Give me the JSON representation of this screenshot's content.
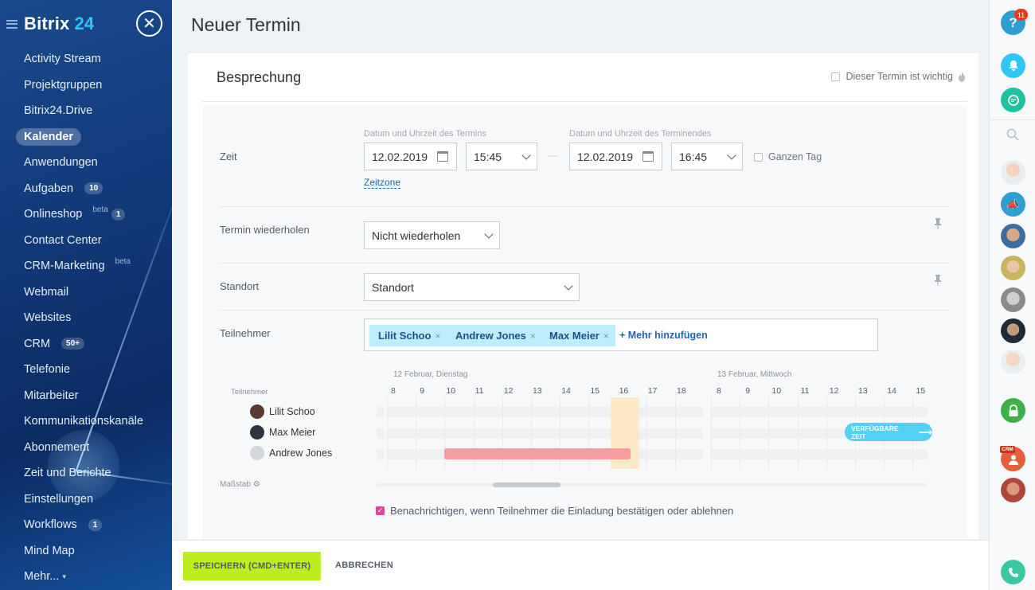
{
  "sidebar": {
    "logo_main": "Bitrix",
    "logo_num": "24",
    "items": [
      {
        "label": "Activity Stream",
        "sup": "",
        "count": ""
      },
      {
        "label": "Projektgruppen",
        "sup": "",
        "count": ""
      },
      {
        "label": "Bitrix24.Drive",
        "sup": "",
        "count": ""
      },
      {
        "label": "Kalender",
        "sup": "",
        "count": "",
        "active": true
      },
      {
        "label": "Anwendungen",
        "sup": "",
        "count": ""
      },
      {
        "label": "Aufgaben",
        "sup": "",
        "count": "10"
      },
      {
        "label": "Onlineshop",
        "sup": "beta",
        "count": "1"
      },
      {
        "label": "Contact Center",
        "sup": "",
        "count": ""
      },
      {
        "label": "CRM-Marketing",
        "sup": "beta",
        "count": ""
      },
      {
        "label": "Webmail",
        "sup": "",
        "count": ""
      },
      {
        "label": "Websites",
        "sup": "",
        "count": ""
      },
      {
        "label": "CRM",
        "sup": "",
        "count": "50+"
      },
      {
        "label": "Telefonie",
        "sup": "",
        "count": ""
      },
      {
        "label": "Mitarbeiter",
        "sup": "",
        "count": ""
      },
      {
        "label": "Kommunikationskanäle",
        "sup": "",
        "count": ""
      },
      {
        "label": "Abonnement",
        "sup": "",
        "count": ""
      },
      {
        "label": "Zeit und Berichte",
        "sup": "",
        "count": ""
      },
      {
        "label": "Einstellungen",
        "sup": "",
        "count": ""
      },
      {
        "label": "Workflows",
        "sup": "",
        "count": "1"
      },
      {
        "label": "Mind Map",
        "sup": "",
        "count": ""
      },
      {
        "label": "Mehr...",
        "sup": "",
        "count": ""
      }
    ]
  },
  "page": {
    "title": "Neuer Termin"
  },
  "card": {
    "title": "Besprechung",
    "important_label": "Dieser Termin ist wichtig"
  },
  "time": {
    "label": "Zeit",
    "start_caption": "Datum und Uhrzeit des Termins",
    "end_caption": "Datum und Uhrzeit des Terminendes",
    "start_date": "12.02.2019",
    "start_time": "15:45",
    "end_date": "12.02.2019",
    "end_time": "16:45",
    "separator": "—",
    "all_day_label": "Ganzen Tag",
    "timezone_link": "Zeitzone"
  },
  "repeat": {
    "label": "Termin wiederholen",
    "value": "Nicht wiederholen"
  },
  "location": {
    "label": "Standort",
    "placeholder": "Standort"
  },
  "participants": {
    "label": "Teilnehmer",
    "tags": [
      "Lilit Schoo",
      "Andrew Jones",
      "Max Meier"
    ],
    "tag_remove": "×",
    "add_more": "+ Mehr hinzufügen"
  },
  "timeline": {
    "col_label": "Teilnehmer",
    "day1": "12 Februar, Dienstag",
    "day2": "13 Februar, Mittwoch",
    "hours_day1": [
      "8",
      "9",
      "10",
      "11",
      "12",
      "13",
      "14",
      "15",
      "16",
      "17",
      "18"
    ],
    "hours_day2": [
      "8",
      "9",
      "10",
      "11",
      "12",
      "13",
      "14",
      "15"
    ],
    "people": [
      "Lilit Schoo",
      "Max Meier",
      "Andrew Jones"
    ],
    "busy": {
      "person": "Andrew Jones",
      "from": 10,
      "to": 17
    },
    "selected": {
      "from": 15.75,
      "to": 16.75
    },
    "free_time_button": "VERFÜGBARE ZEIT",
    "scale_label": "Maßstab",
    "busy_color": "#f79c9f",
    "selected_color": "#fde6bc"
  },
  "notify": {
    "label": "Benachrichtigen, wenn Teilnehmer die Einladung bestätigen oder ablehnen",
    "checked": true
  },
  "footer": {
    "save": "SPEICHERN (CMD+ENTER)",
    "cancel": "ABBRECHEN"
  },
  "rightbar": {
    "help_badge": "11",
    "crm_badge": "CRM"
  }
}
